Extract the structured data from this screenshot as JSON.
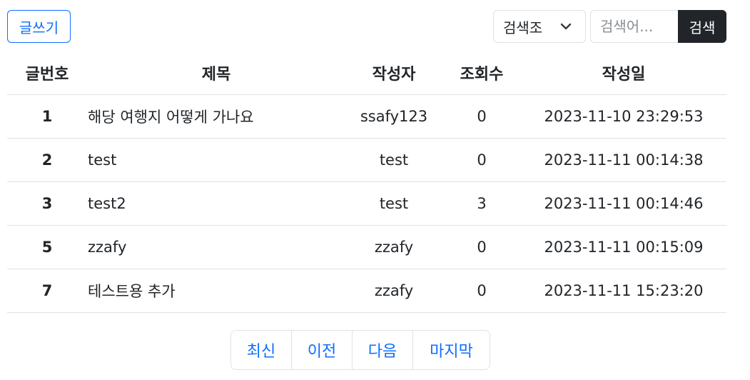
{
  "toolbar": {
    "write_label": "글쓰기",
    "search_select_value": "검색조",
    "search_placeholder": "검색어...",
    "search_button_label": "검색"
  },
  "table": {
    "headers": {
      "num": "글번호",
      "title": "제목",
      "author": "작성자",
      "views": "조회수",
      "date": "작성일"
    },
    "rows": [
      {
        "num": "1",
        "title": "해당 여행지 어떻게 가나요",
        "author": "ssafy123",
        "views": "0",
        "date": "2023-11-10 23:29:53"
      },
      {
        "num": "2",
        "title": "test",
        "author": "test",
        "views": "0",
        "date": "2023-11-11 00:14:38"
      },
      {
        "num": "3",
        "title": "test2",
        "author": "test",
        "views": "3",
        "date": "2023-11-11 00:14:46"
      },
      {
        "num": "5",
        "title": "zzafy",
        "author": "zzafy",
        "views": "0",
        "date": "2023-11-11 00:15:09"
      },
      {
        "num": "7",
        "title": "테스트용 추가",
        "author": "zzafy",
        "views": "0",
        "date": "2023-11-11 15:23:20"
      }
    ]
  },
  "pagination": {
    "first": "최신",
    "prev": "이전",
    "next": "다음",
    "last": "마지막"
  },
  "colors": {
    "accent": "#0d6efd",
    "dark_button": "#212529",
    "border": "#dee2e6"
  }
}
